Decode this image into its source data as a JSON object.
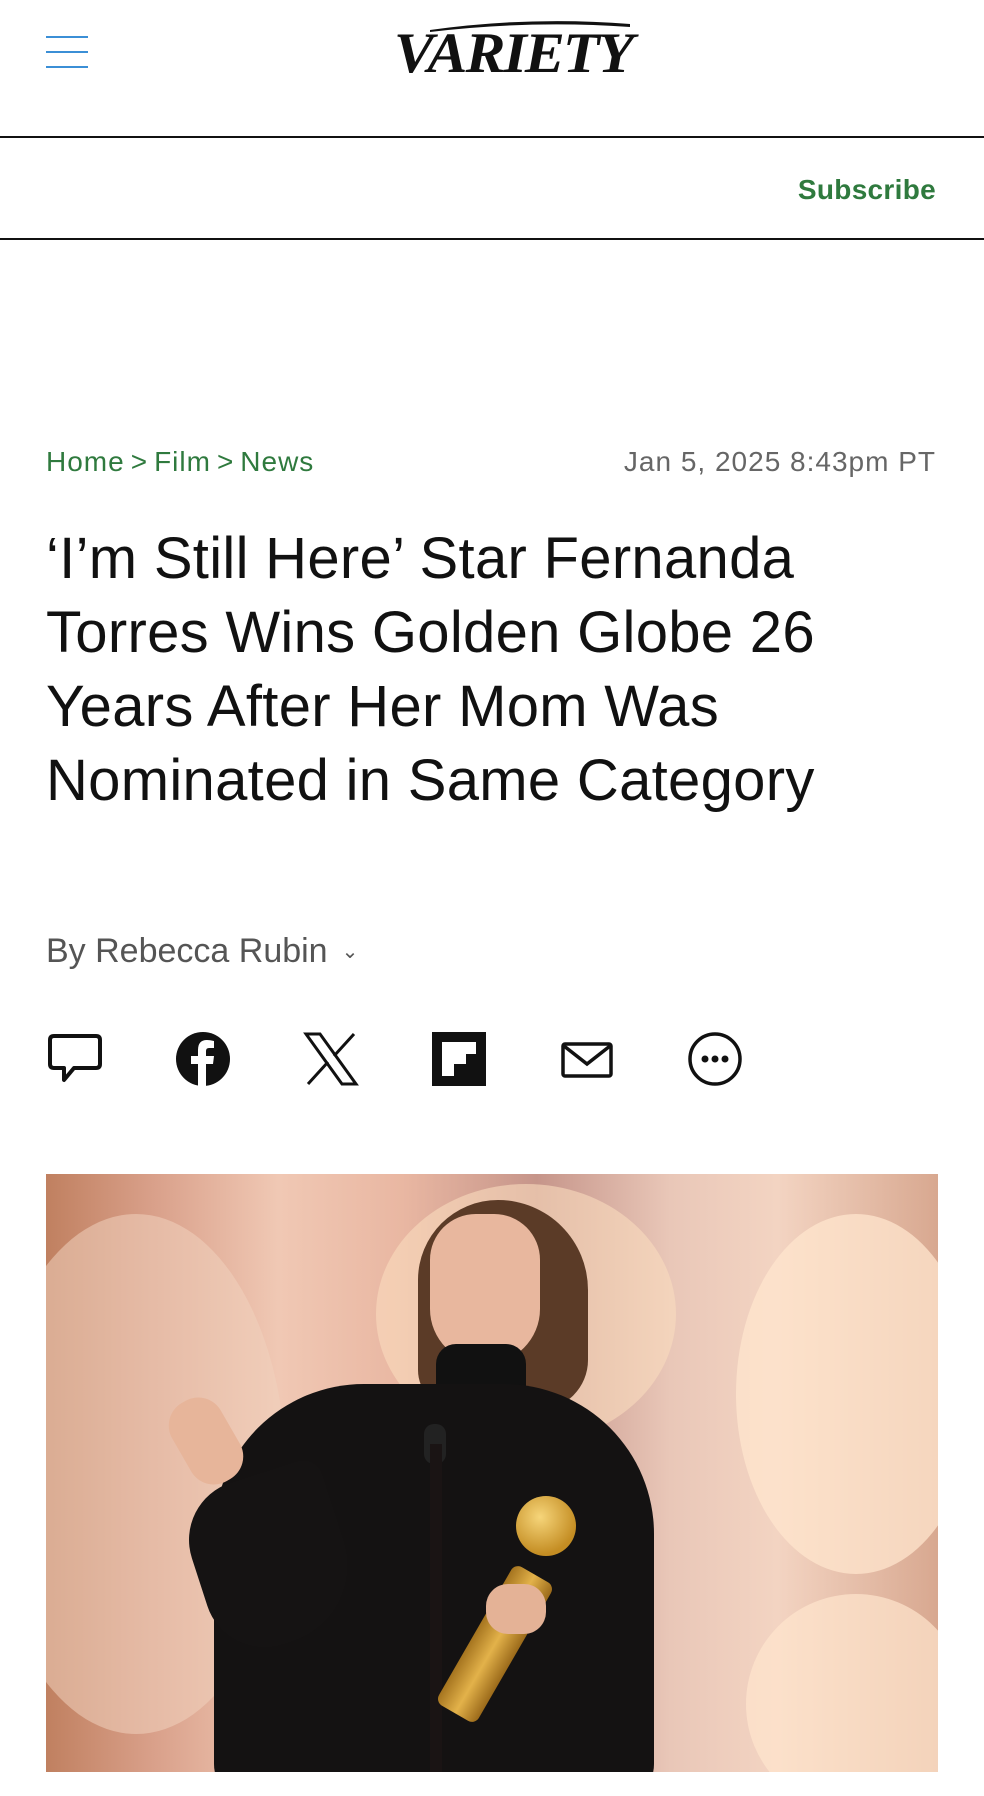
{
  "header": {
    "logo_text": "VARIETY",
    "menu_icon": "hamburger-menu-icon",
    "subscribe_label": "Subscribe",
    "accent_color": "#2f7a3e",
    "menu_color": "#3b8fd6"
  },
  "breadcrumb": {
    "items": [
      "Home",
      "Film",
      "News"
    ],
    "separator": ">"
  },
  "article": {
    "date": "Jan 5, 2025 8:43pm PT",
    "headline": "‘I’m Still Here’ Star Fernanda Torres Wins Golden Globe 26 Years After Her Mom Was Nominated in Same Category",
    "byline": "By Rebecca Rubin",
    "byline_chevron": "⌄"
  },
  "share_icons": [
    "comment-icon",
    "facebook-icon",
    "x-icon",
    "flipboard-icon",
    "email-icon",
    "more-icon"
  ],
  "hero_image": {
    "description_icon": "photo-icon"
  }
}
